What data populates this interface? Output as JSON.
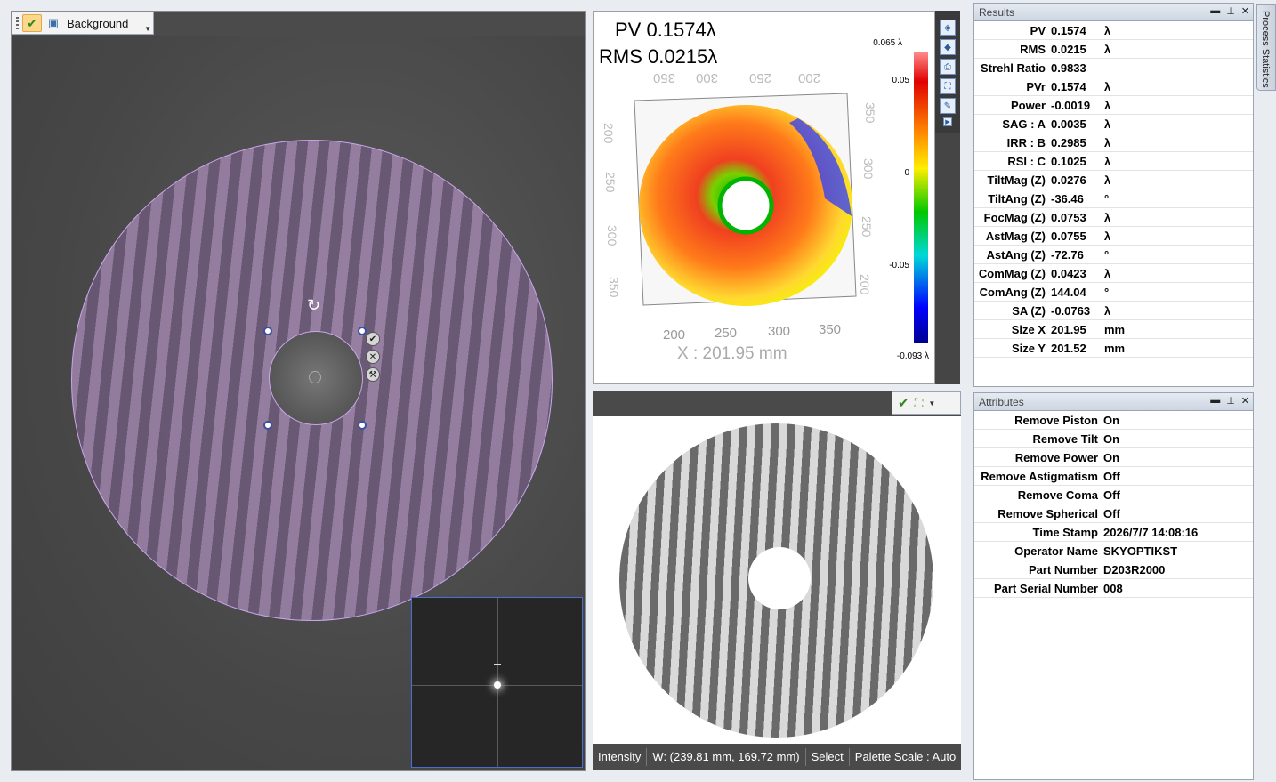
{
  "capture": {
    "toolbar_label": "Background"
  },
  "map": {
    "pv": "PV 0.1574λ",
    "rms": "RMS 0.0215λ",
    "x_label": "X : 201.95 mm",
    "x_ticks": [
      "200",
      "250",
      "300",
      "350"
    ],
    "y_ticks": [
      "200",
      "250",
      "300",
      "350"
    ],
    "back_x_ticks": [
      "350",
      "300",
      "250",
      "200"
    ],
    "back_y_ticks": [
      "350",
      "300",
      "250",
      "200"
    ],
    "left_y_ticks": [
      "200",
      "250",
      "300",
      "350"
    ],
    "colorbar": {
      "max": "0.065 λ",
      "t1": "0.05",
      "t2": "0",
      "t3": "-0.05",
      "min": "-0.093 λ"
    }
  },
  "intensity": {
    "status": {
      "mode": "Intensity",
      "window": "W: (239.81 mm, 169.72 mm)",
      "tool": "Select",
      "palette": "Palette Scale : Auto"
    }
  },
  "results": {
    "title": "Results",
    "rows": [
      {
        "k": "PV",
        "v": "0.1574",
        "u": "λ"
      },
      {
        "k": "RMS",
        "v": "0.0215",
        "u": "λ"
      },
      {
        "k": "Strehl Ratio",
        "v": "0.9833",
        "u": ""
      },
      {
        "k": "PVr",
        "v": "0.1574",
        "u": "λ"
      },
      {
        "k": "Power",
        "v": "-0.0019",
        "u": "λ"
      },
      {
        "k": "SAG : A",
        "v": "0.0035",
        "u": "λ"
      },
      {
        "k": "IRR : B",
        "v": "0.2985",
        "u": "λ"
      },
      {
        "k": "RSI : C",
        "v": "0.1025",
        "u": "λ"
      },
      {
        "k": "TiltMag (Z)",
        "v": "0.0276",
        "u": "λ"
      },
      {
        "k": "TiltAng (Z)",
        "v": "-36.46",
        "u": "°"
      },
      {
        "k": "FocMag (Z)",
        "v": "0.0753",
        "u": "λ"
      },
      {
        "k": "AstMag (Z)",
        "v": "0.0755",
        "u": "λ"
      },
      {
        "k": "AstAng (Z)",
        "v": "-72.76",
        "u": "°"
      },
      {
        "k": "ComMag (Z)",
        "v": "0.0423",
        "u": "λ"
      },
      {
        "k": "ComAng (Z)",
        "v": "144.04",
        "u": "°"
      },
      {
        "k": "SA (Z)",
        "v": "-0.0763",
        "u": "λ"
      },
      {
        "k": "Size X",
        "v": "201.95",
        "u": "mm"
      },
      {
        "k": "Size Y",
        "v": "201.52",
        "u": "mm"
      }
    ]
  },
  "attributes": {
    "title": "Attributes",
    "rows": [
      {
        "k": "Remove Piston",
        "v": "On"
      },
      {
        "k": "Remove Tilt",
        "v": "On"
      },
      {
        "k": "Remove Power",
        "v": "On"
      },
      {
        "k": "Remove Astigmatism",
        "v": "Off"
      },
      {
        "k": "Remove Coma",
        "v": "Off"
      },
      {
        "k": "Remove Spherical",
        "v": "Off"
      },
      {
        "k": "Time Stamp",
        "v": "2026/7/7 14:08:16"
      },
      {
        "k": "Operator Name",
        "v": "SKYOPTIKST"
      },
      {
        "k": "Part Number",
        "v": "D203R2000"
      },
      {
        "k": "Part Serial Number",
        "v": "008"
      }
    ]
  },
  "side_tab": {
    "label": "Process Statistics"
  },
  "colors": {
    "accent": "#3d4fa0",
    "mask": "#c9a6ea"
  }
}
